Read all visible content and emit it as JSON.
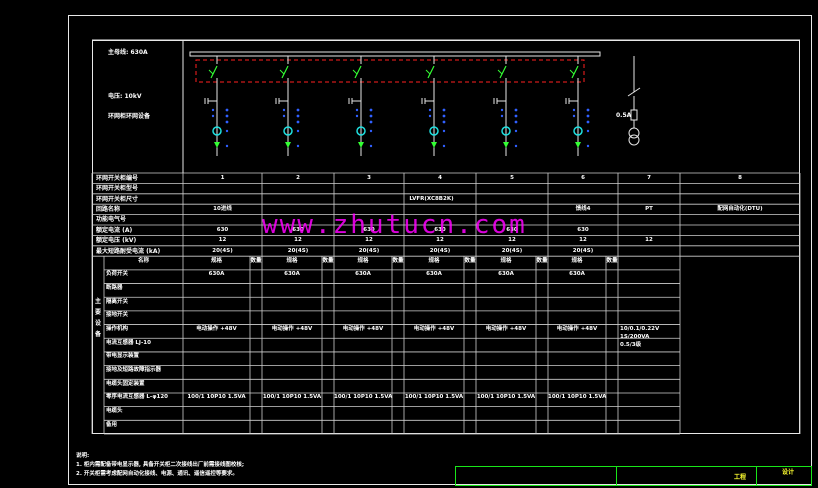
{
  "header": {
    "main_bus": "主母线: 630A",
    "voltage": "电压: 10kV",
    "type": "环网柜环网设备"
  },
  "row_labels": [
    "环网开关柜编号",
    "环网开关柜型号",
    "环网开关柜尺寸",
    "回路名称",
    "功能电气号",
    "额定电流 (A)",
    "额定电压 (kV)",
    "最大短路耐受电流 (kA)"
  ],
  "cabinet_numbers": [
    "1",
    "2",
    "3",
    "4",
    "5",
    "6",
    "7",
    "8"
  ],
  "model_text": "LVFR(XC8B2K)",
  "circuit_names": [
    "10进线",
    "",
    "",
    "",
    "",
    "馈线4",
    "PT",
    "配网自动化(DTU)"
  ],
  "rated_current": [
    "630",
    "630",
    "630",
    "630",
    "630",
    "630"
  ],
  "rated_voltage": [
    "12",
    "12",
    "12",
    "12",
    "12",
    "12",
    "12"
  ],
  "short_circuit": [
    "20(4S)",
    "20(4S)",
    "20(4S)",
    "20(4S)",
    "20(4S)",
    "20(4S)"
  ],
  "equipment_vertical": "主要设备",
  "equip_header": {
    "name": "名称",
    "spec_cols": [
      "规格",
      "规格",
      "规格",
      "规格",
      "规格",
      "规格"
    ],
    "qty": "数量"
  },
  "equip_rows": [
    "负荷开关",
    "断路器",
    "隔离开关",
    "接地开关",
    "操作机构",
    "电流互感器 LJ-10",
    "带电显示装置",
    "接地及短路故障指示器",
    "电缆头固定装置",
    "零序电流互感器 L-φ120",
    "电缆头",
    "备用"
  ],
  "load_switch": [
    "630A",
    "630A",
    "630A",
    "630A",
    "630A",
    "630A"
  ],
  "operation": [
    "电动操作 +48V",
    "电动操作 +48V",
    "电动操作 +48V",
    "电动操作 +48V",
    "电动操作 +48V",
    "电动操作 +48V"
  ],
  "zero_ct": [
    "100/1 10P10 1.5VA",
    "100/1 10P10 1.5VA",
    "100/1 10P10 1.5VA",
    "100/1 10P10 1.5VA",
    "100/1 10P10 1.5VA",
    "100/1 10P10 1.5VA"
  ],
  "pt_spec": [
    "10/0.1/0.22V",
    "1S/200VA",
    "0.5/3级"
  ],
  "fuse_label": "0.5A",
  "watermark": "www.zhutucn.com",
  "notes": [
    "说明:",
    "1. 柜内需配备带电显示器, 具备开关柜二次接线出厂前需接线图校核;",
    "2. 开关柜需考虑配网自动化接线、电源、通讯、遥信遥控等要求。"
  ],
  "title_block": {
    "a": "工程",
    "b": "设计"
  }
}
